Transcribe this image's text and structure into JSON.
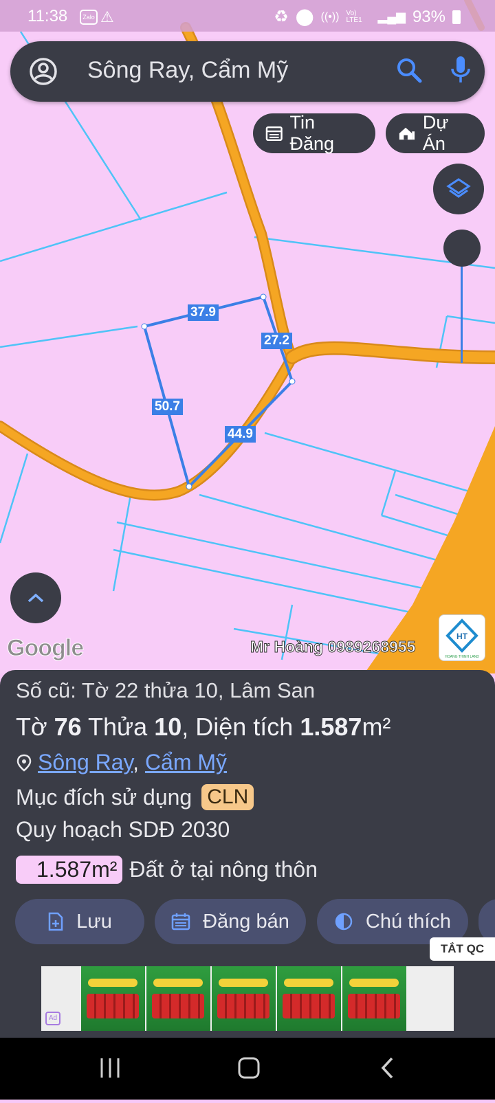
{
  "status_bar": {
    "time": "11:38",
    "app_icon": "Zalo",
    "network_label": "Vo) LTE1",
    "battery": "93%"
  },
  "search": {
    "text": "Sông Ray, Cẩm Mỹ",
    "account_icon": "account-circle-icon",
    "search_icon": "search-icon",
    "mic_icon": "mic-icon"
  },
  "chips": {
    "listings": "Tin Đăng",
    "projects": "Dự Án"
  },
  "map": {
    "measurements": [
      "37.9",
      "27.2",
      "50.7",
      "44.9"
    ],
    "google_label": "Google",
    "watermark": "Mr Hoàng 0989268955",
    "logo_text": "HOANG THINH LAND",
    "colors": {
      "land": "#f8ccf8",
      "road": "#f5a623",
      "parcel_line": "#4fc3f7",
      "selection": "#3b7fe6"
    }
  },
  "info": {
    "old_parcel": "Số cũ: Tờ 22 thửa 10, Lâm San",
    "sheet_label": "Tờ",
    "sheet_no": "76",
    "parcel_label": "Thửa",
    "parcel_no": "10",
    "area_label": "Diện tích",
    "area_value": "1.587",
    "area_unit": "m²",
    "commune": "Sông Ray",
    "district": "Cẩm Mỹ",
    "land_use_label": "Mục đích sử dụng",
    "land_use_code": "CLN",
    "plan_label": "Quy hoạch SDĐ 2030",
    "plan_area": "1.587m²",
    "plan_type": "Đất ở tại nông thôn"
  },
  "actions": {
    "save": "Lưu",
    "post_sale": "Đăng bán",
    "legend": "Chú thích"
  },
  "ad": {
    "hide_label": "TẮT QC",
    "ad_badge": "Ad"
  }
}
